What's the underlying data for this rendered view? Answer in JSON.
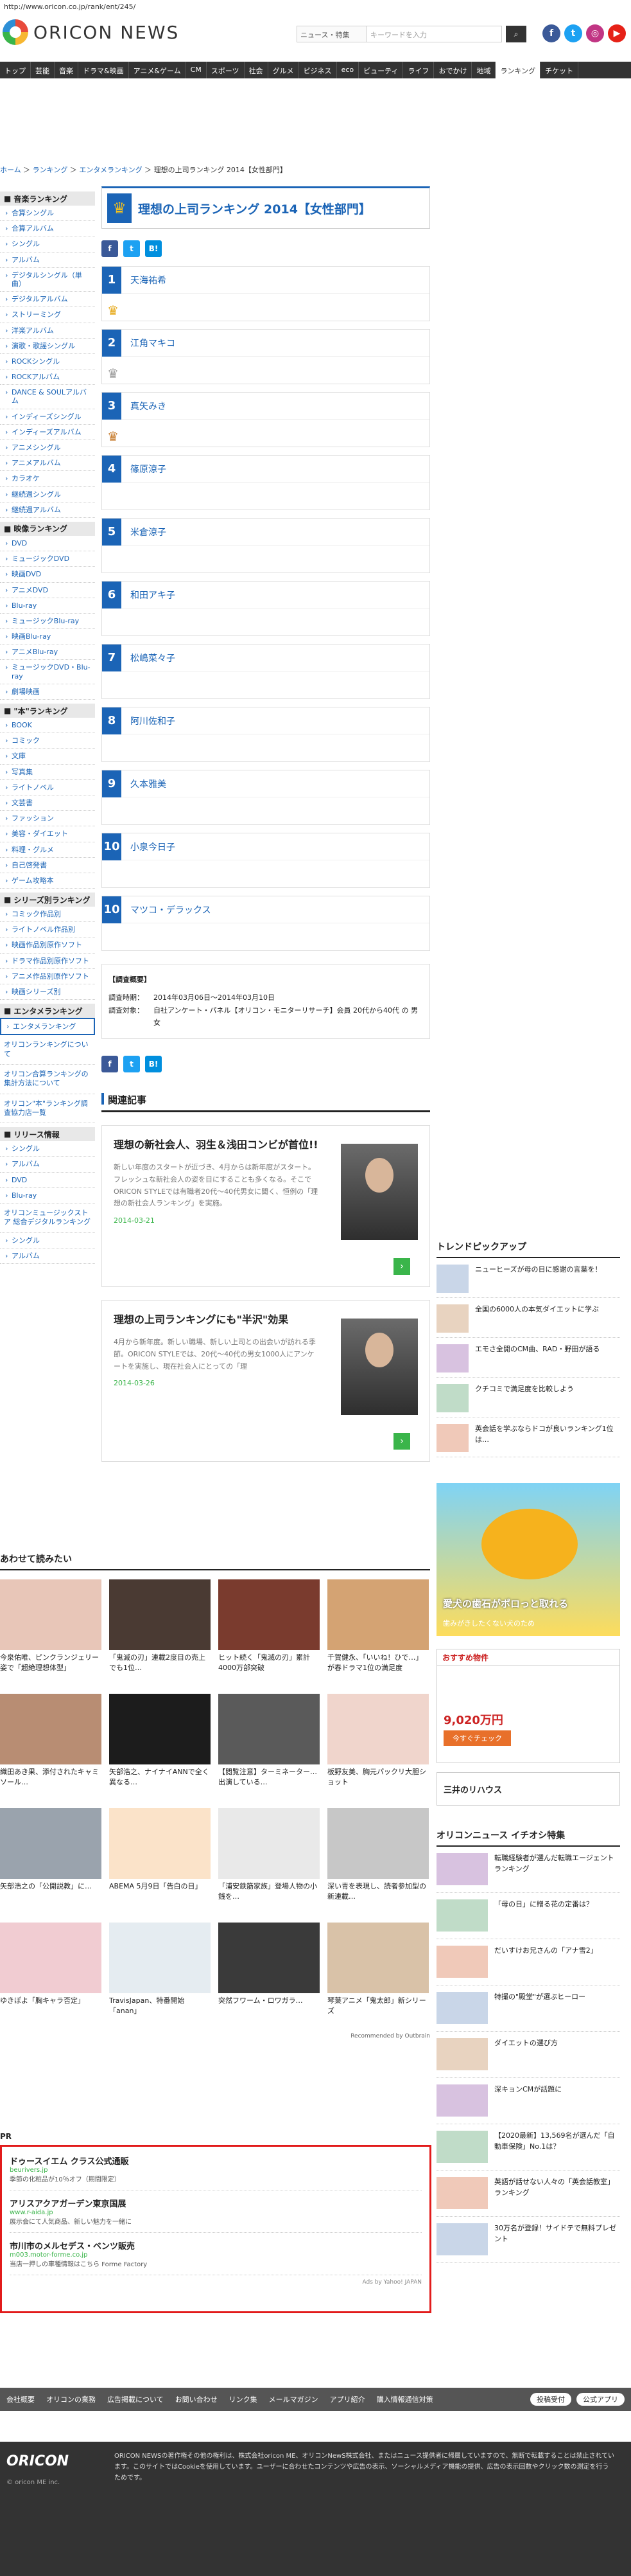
{
  "url": "http://www.oricon.co.jp/rank/ent/245/",
  "brand": {
    "name": "ORICON NEWS"
  },
  "search": {
    "select_label": "ニュース・特集",
    "placeholder": "キーワードを入力"
  },
  "nav": [
    "トップ",
    "芸能",
    "音楽",
    "ドラマ&映画",
    "アニメ&ゲーム",
    "CM",
    "スポーツ",
    "社会",
    "グルメ",
    "ビジネス",
    "eco",
    "ビューティ",
    "ライフ",
    "おでかけ",
    "地域",
    "ランキング",
    "チケット"
  ],
  "breadcrumb": [
    "ホーム",
    "ランキング",
    "エンタメランキング",
    "理想の上司ランキング 2014【女性部門】"
  ],
  "sidebar": {
    "music_title": "音楽ランキング",
    "music": [
      "合算シングル",
      "合算アルバム",
      "シングル",
      "アルバム",
      "デジタルシングル（単曲）",
      "デジタルアルバム",
      "ストリーミング",
      "洋楽アルバム",
      "演歌・歌謡シングル",
      "ROCKシングル",
      "ROCKアルバム",
      "DANCE & SOULアルバム",
      "インディーズシングル",
      "インディーズアルバム",
      "アニメシングル",
      "アニメアルバム",
      "カラオケ",
      "継続週シングル",
      "継続週アルバム"
    ],
    "video_title": "映像ランキング",
    "video": [
      "DVD",
      "ミュージックDVD",
      "映画DVD",
      "アニメDVD",
      "Blu-ray",
      "ミュージックBlu-ray",
      "映画Blu-ray",
      "アニメBlu-ray",
      "ミュージックDVD・Blu-ray",
      "劇場映画"
    ],
    "book_title": "\"本\"ランキング",
    "book": [
      "BOOK",
      "コミック",
      "文庫",
      "写真集",
      "ライトノベル",
      "文芸書",
      "ファッション",
      "美容・ダイエット",
      "料理・グルメ",
      "自己啓発書",
      "ゲーム攻略本"
    ],
    "series_title": "シリーズ別ランキング",
    "series": [
      "コミック作品別",
      "ライトノベル作品別",
      "映画作品別原作ソフト",
      "ドラマ作品別原作ソフト",
      "アニメ作品別原作ソフト",
      "映画シリーズ別"
    ],
    "ent_title": "エンタメランキング",
    "ent": [
      "エンタメランキング"
    ],
    "links": [
      "オリコンランキングについて",
      "オリコン合算ランキングの集計方法について",
      "オリコン\"本\"ランキング調査協力店一覧"
    ],
    "release_title": "リリース情報",
    "release": [
      "シングル",
      "アルバム",
      "DVD",
      "Blu-ray"
    ],
    "release2": [
      "オリコンミュージックストア\n総合デジタルランキング"
    ],
    "release3": [
      "シングル",
      "アルバム"
    ]
  },
  "ranking": {
    "title": "理想の上司ランキング 2014【女性部門】",
    "share": {
      "facebook": "f",
      "twitter": "t",
      "hatena": "B!"
    },
    "items": [
      {
        "rank": "1",
        "name": "天海祐希",
        "crown": "gold"
      },
      {
        "rank": "2",
        "name": "江角マキコ",
        "crown": "silver"
      },
      {
        "rank": "3",
        "name": "真矢みき",
        "crown": "bronze"
      },
      {
        "rank": "4",
        "name": "篠原涼子"
      },
      {
        "rank": "5",
        "name": "米倉涼子"
      },
      {
        "rank": "6",
        "name": "和田アキ子"
      },
      {
        "rank": "7",
        "name": "松嶋菜々子"
      },
      {
        "rank": "8",
        "name": "阿川佐和子"
      },
      {
        "rank": "9",
        "name": "久本雅美"
      },
      {
        "rank": "10",
        "name": "小泉今日子"
      },
      {
        "rank": "10",
        "name": "マツコ・デラックス"
      }
    ],
    "survey": {
      "title": "【調査概要】",
      "period_label": "調査時期：",
      "period": "2014年03月06日～2014年03月10日",
      "target_label": "調査対象：",
      "target": "自社アンケート・パネル【オリコン・モニターリサーチ】会員 20代から40代 の 男女"
    }
  },
  "related": {
    "title": "関連記事",
    "articles": [
      {
        "title": "理想の新社会人、羽生＆浅田コンビが首位!!",
        "excerpt": "新しい年度のスタートが近づき、4月からは新年度がスタート。フレッシュな新社会人の姿を目にすることも多くなる。そこでORICON STYLEでは有職者20代〜40代男女に聞く、恒例の「理想の新社会人ランキング」を実施。",
        "date": "2014-03-21"
      },
      {
        "title": "理想の上司ランキングにも\"半沢\"効果",
        "excerpt": "4月から新年度。新しい職場、新しい上司との出会いが訪れる季節。ORICON STYLEでは、20代〜40代の男女1000人にアンケートを実施し、現在社会人にとっての「理",
        "date": "2014-03-26"
      }
    ]
  },
  "trend": {
    "title": "トレンドピックアップ",
    "items": [
      "ニューヒーズが母の日に感謝の言葉を！",
      "全国の6000人の本気ダイエットに学ぶ",
      "エモさ全開のCM曲、RAD・野田が語る",
      "クチコミで満足度を比較しよう",
      "英会話を学ぶならドコが良いランキング1位は…"
    ]
  },
  "ad": {
    "duck_caption": "愛犬の歯石がポロっと取れる",
    "duck_sub": "歯みがきしたくない犬のため"
  },
  "recommend": {
    "title": "おすすめ物件",
    "price": "9,020万円",
    "cta": "今すぐチェック"
  },
  "banner": {
    "text": "三井のリハウス"
  },
  "featured": {
    "title": "オリコンニュース イチオシ特集",
    "items": [
      "転職経験者が選んだ転職エージェントランキング",
      "「母の日」に贈る花の定番は？",
      "だいすけお兄さんの「アナ雪2」",
      "特撮の\"殿堂\"が選ぶヒーロー",
      "ダイエットの選び方",
      "深キョンCMが話題に",
      "【2020最新】13,569名が選んだ「自動車保険」No.1は？",
      "英語が話せない人々の「英会話教室」ランキング",
      "30万名が登録！サイドテで無料プレゼント"
    ]
  },
  "read_together": {
    "title": "あわせて読みたい",
    "cards": [
      "今泉佑唯、ピンクランジェリー姿で「超絶理想体型」",
      "「鬼滅の刃」連載2度目の売上でも1位…",
      "ヒット続く「鬼滅の刃」累計4000万部突破",
      "千賀健永、「いいね！ひで…」が春ドラマ1位の満足度",
      "織田あき果、添付されたキャミソール…",
      "矢部浩之、ナイナイANNで全く異なる…",
      "【閲覧注意】ターミネーター…出演している…",
      "板野友美、胸元パックリ大胆ショット",
      "矢部浩之の「公開説教」に…",
      "ABEMA 5月9日「告白の日」",
      "「浦安鉄筋家族」登場人物の小銭を…",
      "深い青を表現し、読者参加型の新連載…",
      "ゆきぽよ「胸キャラ否定」",
      "TravisJapan、特番開始「anan」",
      "突然フワーム・ロワガラ…",
      "琴葉アニメ「鬼太郎」新シリーズ"
    ],
    "credit": "Recommended by Outbrain"
  },
  "pr": {
    "label": "PR",
    "items": [
      {
        "title": "ドゥースイエム クラス公式通販",
        "url": "beurivers.jp",
        "desc": "季節の化粧品が10％オフ（期間限定）"
      },
      {
        "title": "アリスアクアガーデン東京国展",
        "url": "www.r-aida.jp",
        "desc": "展示会にて人気商品、新しい魅力を一緒に"
      },
      {
        "title": "市川市のメルセデス・ベンツ販売",
        "url": "m003.motor-forme.co.jp",
        "desc": "当店一押しの車種情報はこちら Forme Factory"
      }
    ],
    "footer": "Ads by Yahoo! JAPAN"
  },
  "footer_nav": [
    "会社概要",
    "オリコンの業務",
    "広告掲載について",
    "お問い合わせ",
    "リンク集",
    "メールマガジン",
    "アプリ紹介",
    "購入情報通信対策"
  ],
  "footer_points": [
    "投稿受付",
    "公式アプリ"
  ],
  "footer": {
    "logo": "ORICON",
    "copyright": "© oricon ME inc.",
    "text": "ORICON NEWSの著作権その他の権利は、株式会社oricon ME、オリコンNewS株式会社、またはニュース提供者に帰属していますので、無断で転載することは禁止されています。このサイトではCookieを使用しています。ユーザーに合わせたコンテンツや広告の表示、ソーシャルメディア機能の提供、広告の表示回数やクリック数の測定を行うためです。"
  },
  "colors": {
    "accent": "#1b64b6",
    "nav": "#333333",
    "date": "#3ab54a",
    "pr_border": "#e21b1b"
  }
}
